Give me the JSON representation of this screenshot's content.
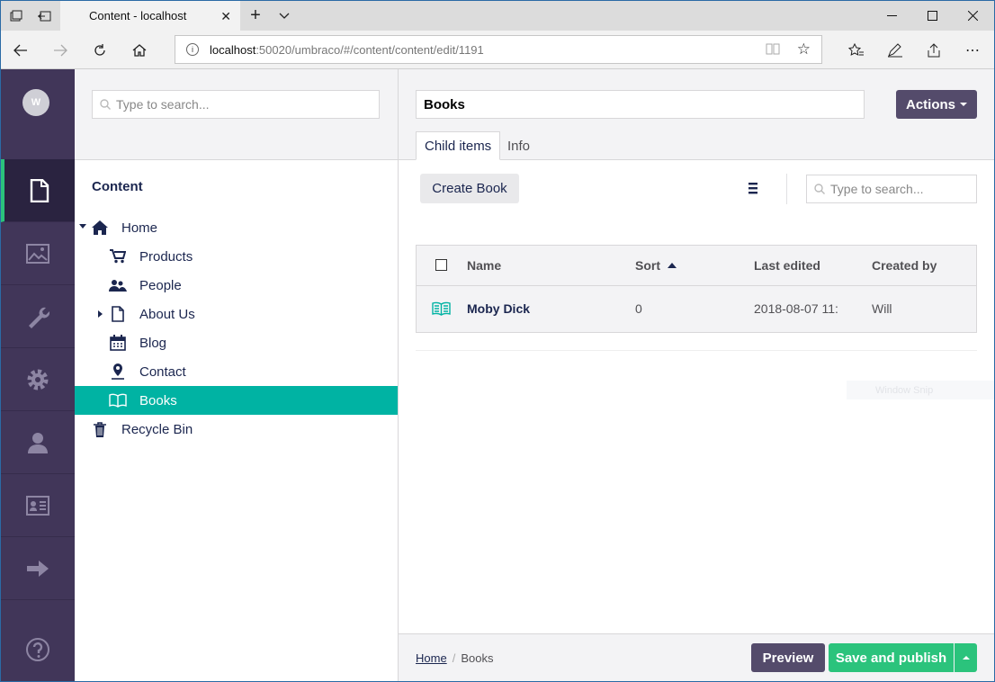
{
  "browser": {
    "tab_title": "Content - localhost",
    "url_host": "localhost",
    "url_rest": ":50020/umbraco/#/content/content/edit/1191"
  },
  "user": {
    "initial": "W"
  },
  "tree": {
    "search_placeholder": "Type to search...",
    "title": "Content",
    "nodes": [
      {
        "label": "Home",
        "icon": "home-icon"
      },
      {
        "label": "Products",
        "icon": "cart-icon"
      },
      {
        "label": "People",
        "icon": "people-icon"
      },
      {
        "label": "About Us",
        "icon": "document-icon"
      },
      {
        "label": "Blog",
        "icon": "calendar-icon"
      },
      {
        "label": "Contact",
        "icon": "map-pin-icon"
      },
      {
        "label": "Books",
        "icon": "book-icon"
      },
      {
        "label": "Recycle Bin",
        "icon": "trash-icon"
      }
    ]
  },
  "editor": {
    "name_value": "Books",
    "actions_label": "Actions",
    "tabs": [
      {
        "label": "Child items"
      },
      {
        "label": "Info"
      }
    ],
    "create_label": "Create Book",
    "search_placeholder": "Type to search...",
    "columns": [
      "Name",
      "Sort",
      "Last edited",
      "Created by"
    ],
    "rows": [
      {
        "name": "Moby Dick",
        "sort": "0",
        "last_edited": "2018-08-07 11:",
        "created_by": "Will"
      }
    ],
    "watermark": "Window Snip"
  },
  "footer": {
    "breadcrumb": [
      "Home",
      "Books"
    ],
    "preview_label": "Preview",
    "publish_label": "Save and publish"
  },
  "colors": {
    "section_bar": "#413659",
    "selected_node": "#00b3a3",
    "publish": "#2bc37c",
    "actions": "#544b6b"
  }
}
